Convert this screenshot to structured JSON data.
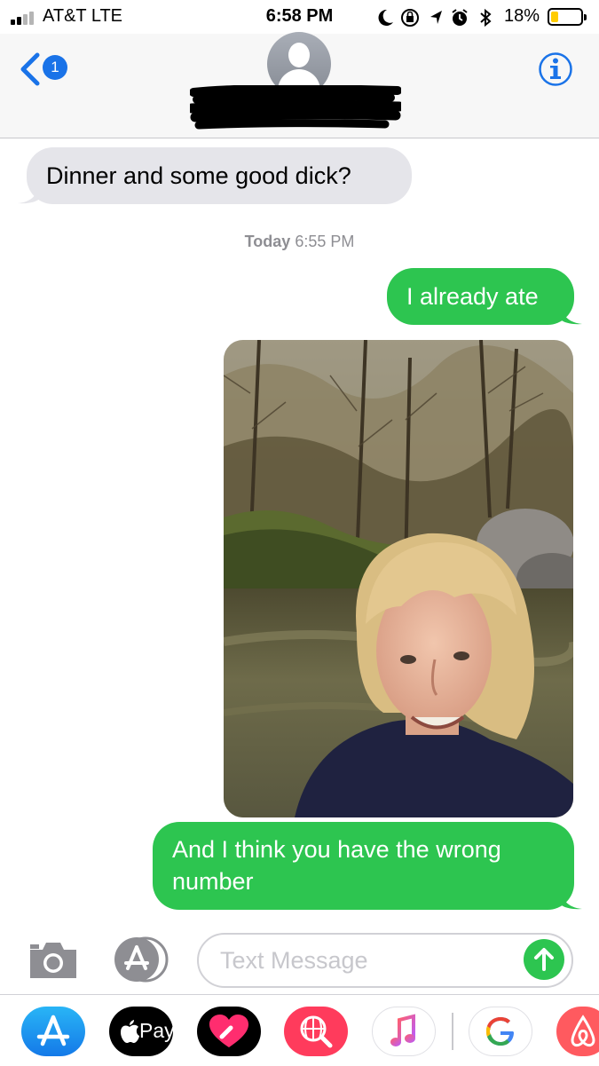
{
  "status_bar": {
    "carrier": "AT&T  LTE",
    "time": "6:58 PM",
    "battery_percent": "18%",
    "battery_level": 0.18,
    "icons": [
      "signal-icon",
      "do-not-disturb-icon",
      "orientation-lock-icon",
      "location-icon",
      "alarm-icon",
      "bluetooth-icon",
      "battery-icon"
    ]
  },
  "header": {
    "back_badge_count": "1",
    "contact_name": "",
    "info_icon": "info-icon"
  },
  "conversation": {
    "received_message": "Dinner and some good dick?",
    "timestamp_day": "Today",
    "timestamp_time": " 6:55 PM",
    "sent_message_1": "I already ate",
    "photo": "selfie-by-creek",
    "sent_message_2": "And I think you have the wrong number"
  },
  "input": {
    "placeholder": "Text Message"
  },
  "app_drawer": {
    "apps": [
      "App Store",
      "Apple Pay",
      "Digital Touch",
      "#images",
      "Music",
      "Google",
      "Airbnb"
    ],
    "apple_pay_label": "Pay"
  },
  "colors": {
    "sent_bubble": "#2dc550",
    "received_bubble": "#e5e5ea",
    "accent": "#1a73e8"
  }
}
